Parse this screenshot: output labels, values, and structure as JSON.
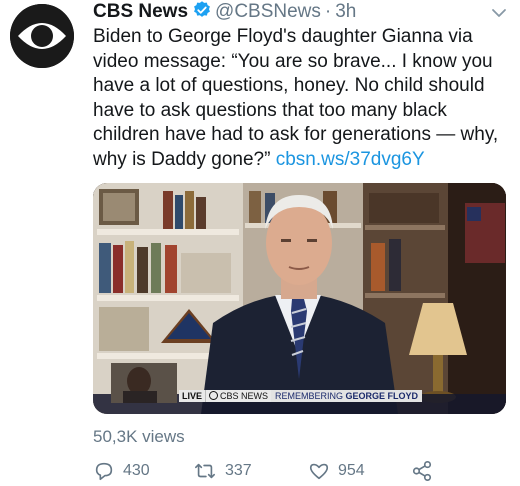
{
  "account": {
    "name": "CBS News",
    "handle": "@CBSNews",
    "separator": "·",
    "time": "3h",
    "avatar_icon": "cbs-eye-logo-icon",
    "verified_icon": "verified-badge-icon"
  },
  "tweet": {
    "text": "Biden to George Floyd's daughter Gianna via video message: “You are so brave... I know you have a lot of questions, honey. No child should have to ask questions that too many black children have had to ask for generations — why, why is Daddy gone?” ",
    "link": "cbsn.ws/37dvg6Y"
  },
  "media": {
    "lower_third": {
      "live": "LIVE",
      "network": "CBS NEWS",
      "message_prefix": "REMEMBERING ",
      "message_name": "GEORGE FLOYD"
    }
  },
  "stats": {
    "views": "50,3K views"
  },
  "actions": {
    "reply_count": "430",
    "retweet_count": "337",
    "like_count": "954",
    "reply_icon": "reply-icon",
    "retweet_icon": "retweet-icon",
    "like_icon": "heart-icon",
    "share_icon": "share-icon"
  },
  "colors": {
    "link": "#1b95e0",
    "verified": "#1da1f2",
    "muted": "#657786"
  }
}
